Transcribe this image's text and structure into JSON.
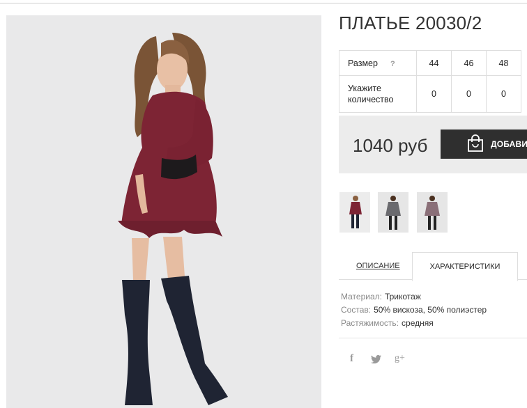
{
  "product": {
    "title": "ПЛАТЬЕ 20030/2",
    "photo_icon": "dress-photo"
  },
  "size_table": {
    "size_label": "Размер",
    "help_icon": "?",
    "sizes": [
      "44",
      "46",
      "48"
    ],
    "qty_label": "Укажите количество",
    "quantities": [
      "0",
      "0",
      "0"
    ]
  },
  "price": {
    "value": "1040 руб",
    "buy_label": "ДОБАВИТЬ",
    "buy_icon": "shopping-bag-icon"
  },
  "tabs": {
    "description": "ОПИСАНИЕ",
    "specs": "ХАРАКТЕРИСТИКИ",
    "active": "specs"
  },
  "specs": [
    {
      "key": "Материал:",
      "value": "Трикотаж"
    },
    {
      "key": "Состав:",
      "value": "50% вискоза, 50% полиэстер"
    },
    {
      "key": "Растяжимость:",
      "value": "средняя"
    }
  ],
  "social": {
    "facebook": "f",
    "twitter": "twitter-bird-icon",
    "google_plus": "g+"
  },
  "colors": {
    "dress_burgundy": "#7d2434",
    "dress_grey": "#6a6a6e",
    "dress_mauve": "#8a6f78",
    "boots": "#1f2433",
    "button_dark": "#2f2f2f",
    "price_box": "#ececec"
  }
}
